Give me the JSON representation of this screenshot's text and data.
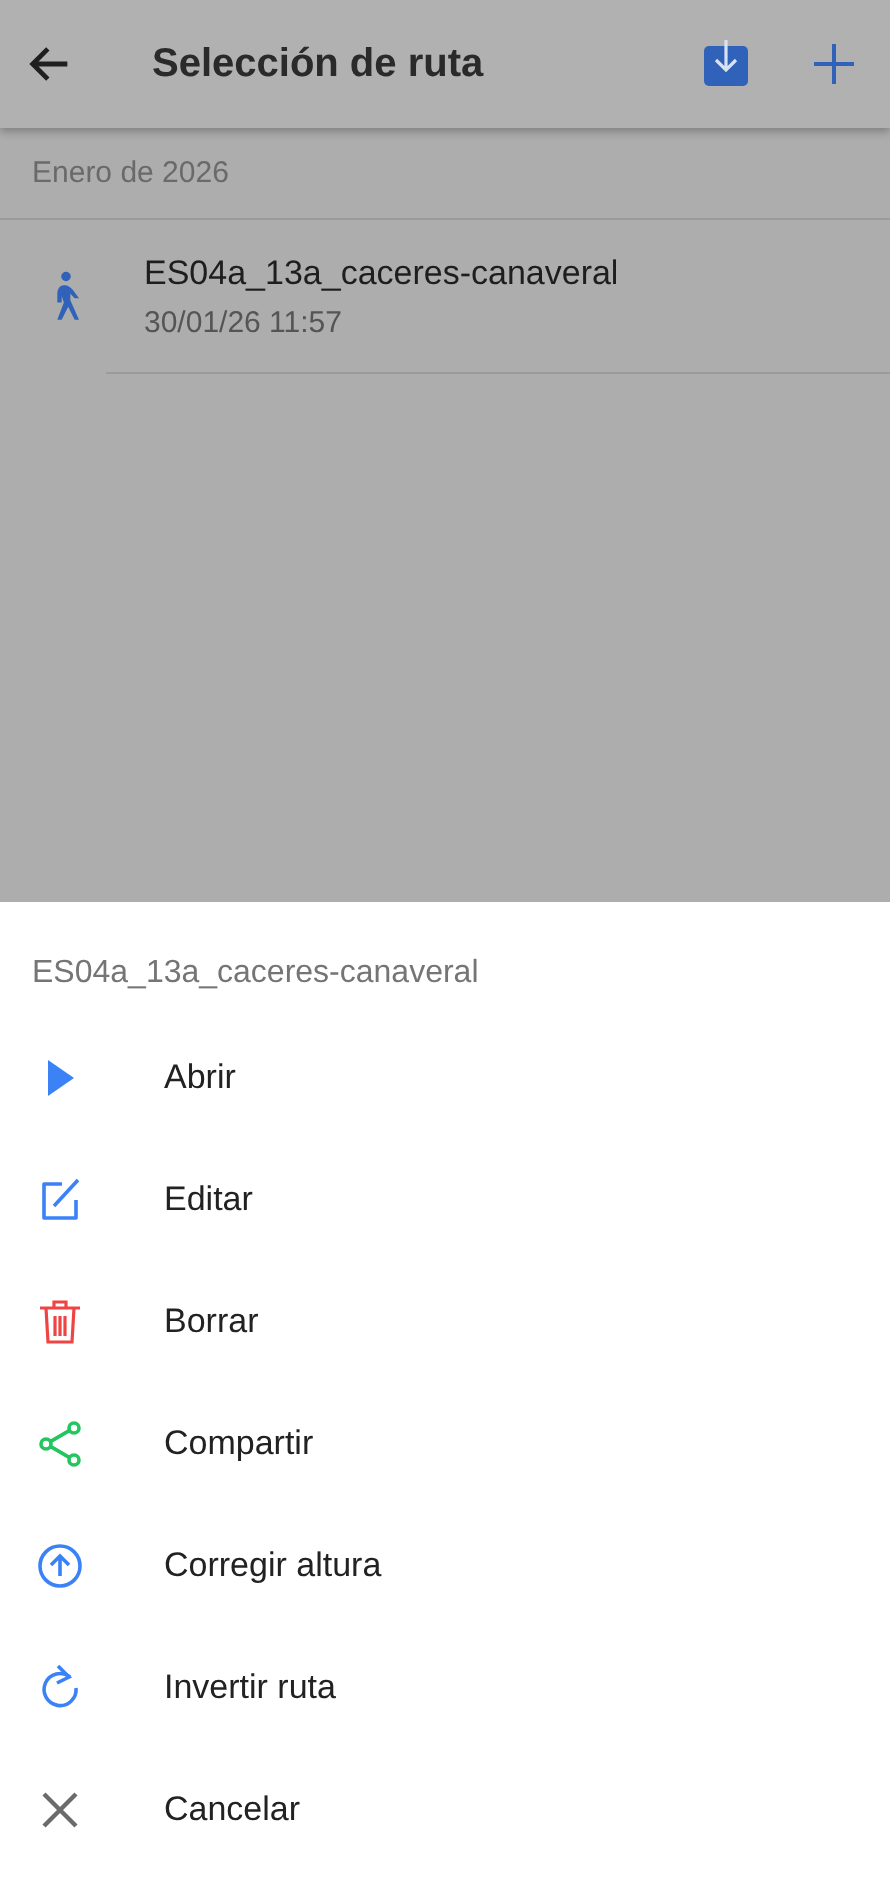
{
  "header": {
    "title": "Selección de ruta"
  },
  "section": {
    "label": "Enero de 2026"
  },
  "routes": [
    {
      "name": "ES04a_13a_caceres-canaveral",
      "date": "30/01/26 11:57"
    }
  ],
  "sheet": {
    "title": "ES04a_13a_caceres-canaveral",
    "items": [
      {
        "label": "Abrir",
        "kind": "play",
        "color": "#3b82f6"
      },
      {
        "label": "Editar",
        "kind": "edit",
        "color": "#3b82f6"
      },
      {
        "label": "Borrar",
        "kind": "trash",
        "color": "#ef4444"
      },
      {
        "label": "Compartir",
        "kind": "share",
        "color": "#22c55e"
      },
      {
        "label": "Corregir altura",
        "kind": "up",
        "color": "#3b82f6"
      },
      {
        "label": "Invertir ruta",
        "kind": "redo",
        "color": "#3b82f6"
      },
      {
        "label": "Cancelar",
        "kind": "close",
        "color": "#6b6b6b"
      }
    ]
  }
}
